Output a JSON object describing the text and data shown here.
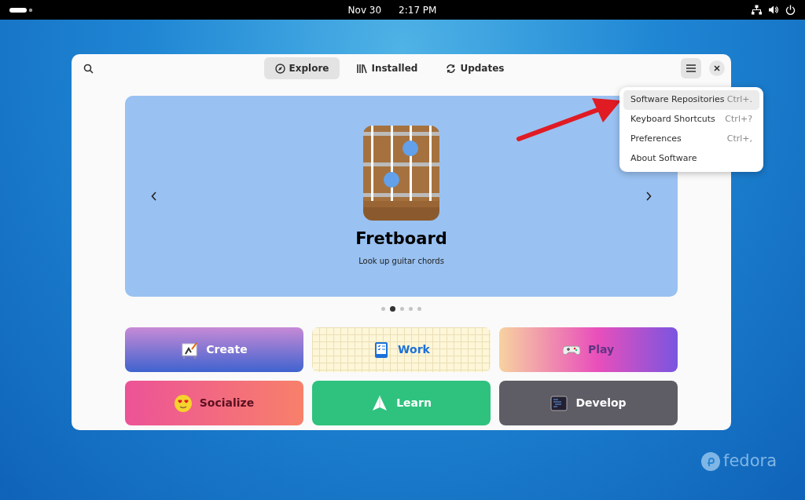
{
  "top_bar": {
    "date": "Nov 30",
    "time": "2:17 PM"
  },
  "header": {
    "tabs": [
      {
        "label": "Explore",
        "selected": true
      },
      {
        "label": "Installed",
        "selected": false
      },
      {
        "label": "Updates",
        "selected": false
      }
    ]
  },
  "featured": {
    "title": "Fretboard",
    "subtitle": "Look up guitar chords",
    "dots": [
      {
        "selected": false
      },
      {
        "selected": true
      },
      {
        "selected": false
      },
      {
        "selected": false
      },
      {
        "selected": false
      }
    ]
  },
  "categories": [
    {
      "label": "Create",
      "kind": "create"
    },
    {
      "label": "Work",
      "kind": "work"
    },
    {
      "label": "Play",
      "kind": "play"
    },
    {
      "label": "Socialize",
      "kind": "socialize"
    },
    {
      "label": "Learn",
      "kind": "learn"
    },
    {
      "label": "Develop",
      "kind": "develop"
    }
  ],
  "menu": {
    "items": [
      {
        "label": "Software Repositories",
        "shortcut": "Ctrl+.",
        "selected": true
      },
      {
        "label": "Keyboard Shortcuts",
        "shortcut": "Ctrl+?",
        "selected": false
      },
      {
        "label": "Preferences",
        "shortcut": "Ctrl+,",
        "selected": false
      },
      {
        "label": "About Software",
        "selected": false
      }
    ]
  },
  "desktop_logo": {
    "text": "fedora"
  }
}
